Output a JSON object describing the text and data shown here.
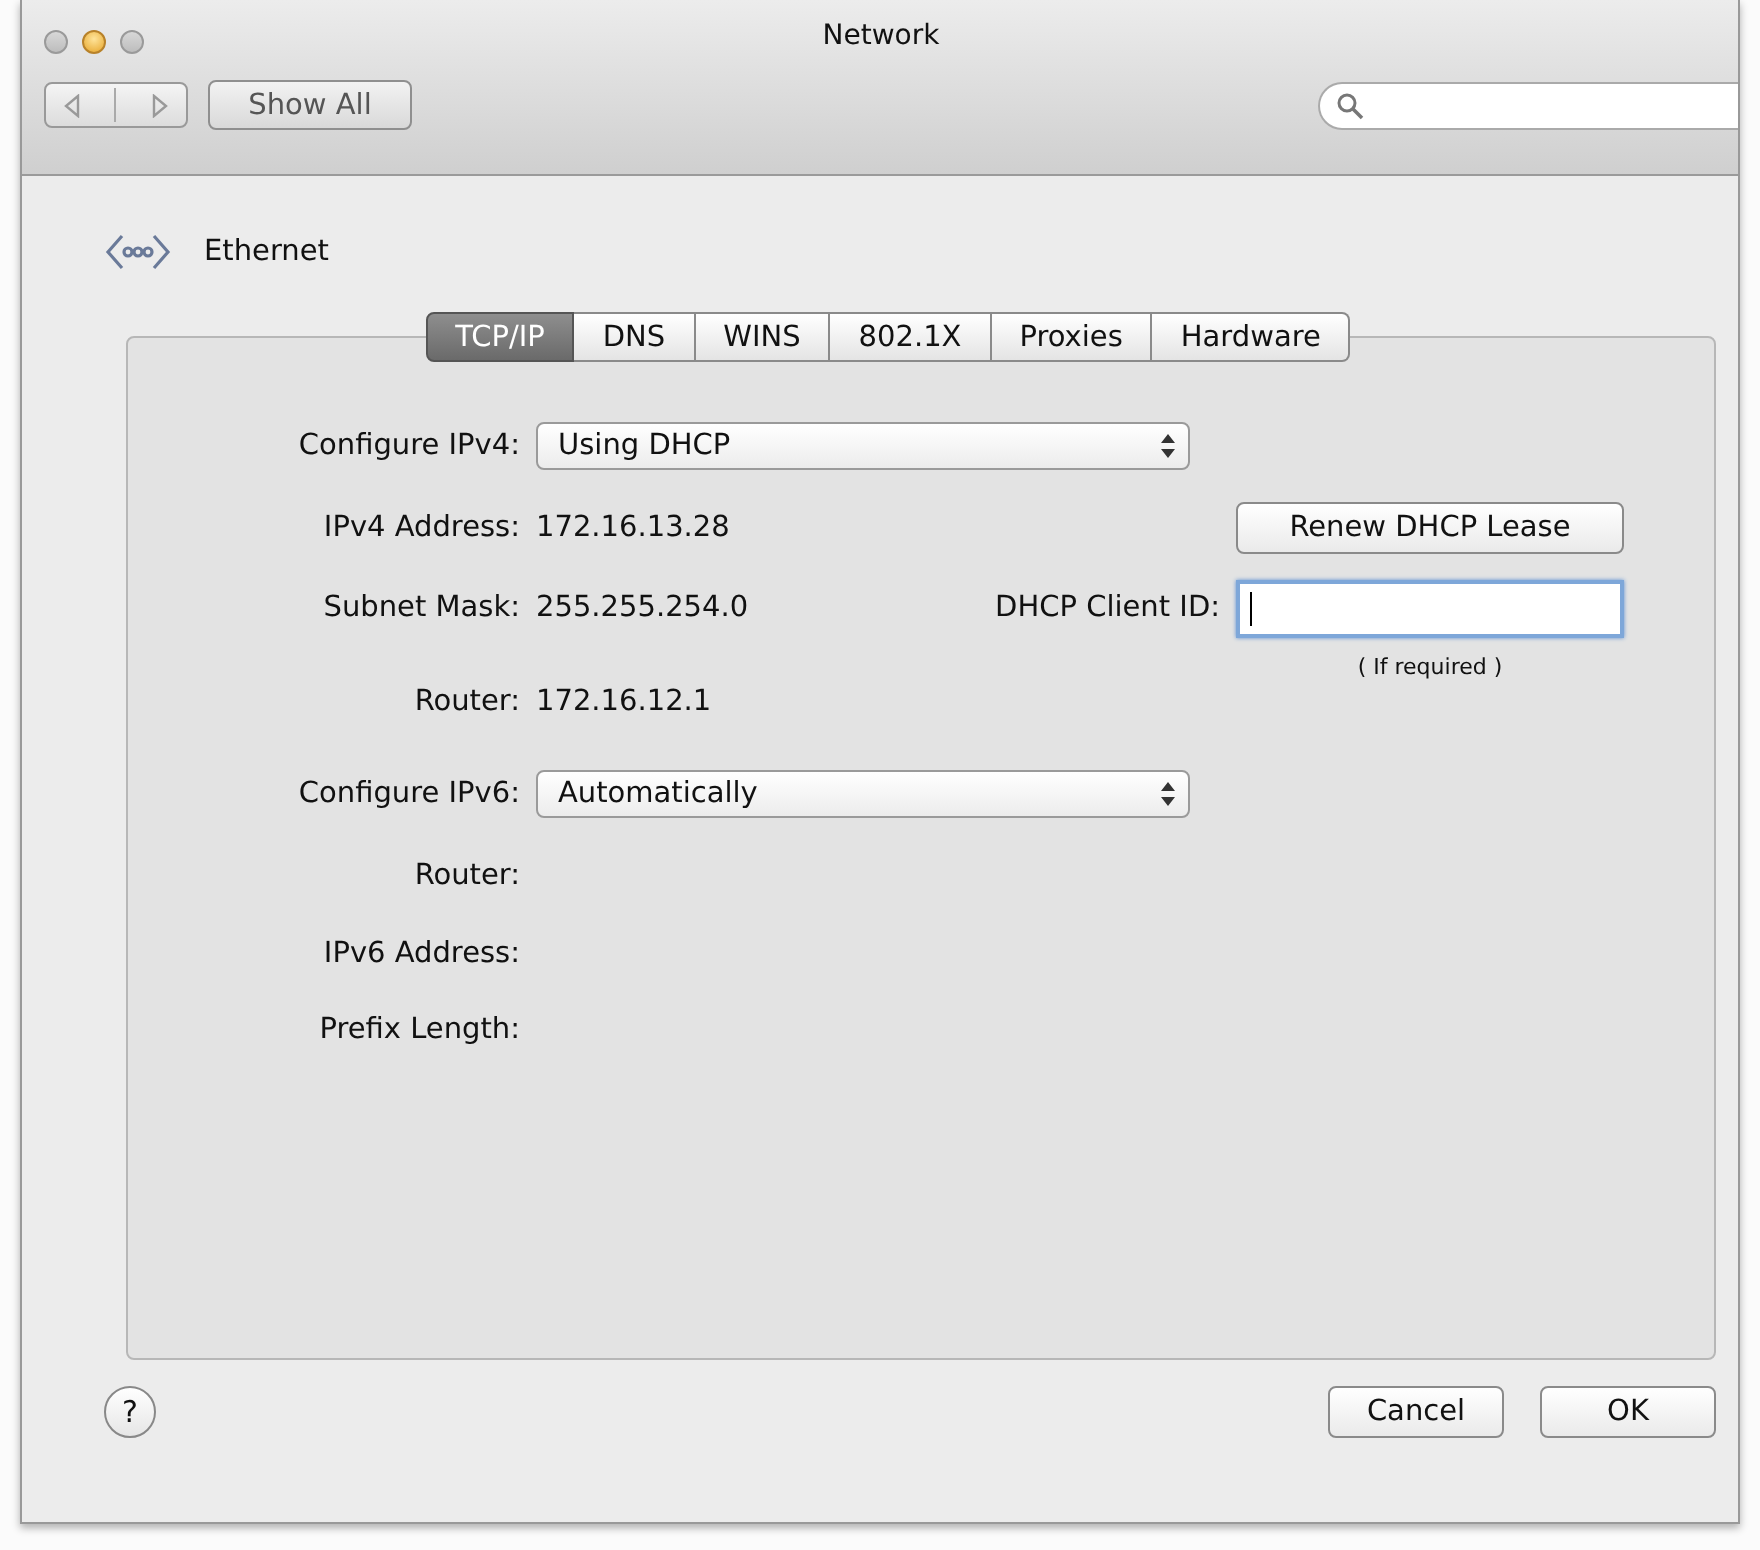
{
  "window": {
    "title": "Network"
  },
  "toolbar": {
    "show_all": "Show All"
  },
  "service": {
    "name": "Ethernet"
  },
  "tabs": [
    {
      "label": "TCP/IP",
      "selected": true
    },
    {
      "label": "DNS",
      "selected": false
    },
    {
      "label": "WINS",
      "selected": false
    },
    {
      "label": "802.1X",
      "selected": false
    },
    {
      "label": "Proxies",
      "selected": false
    },
    {
      "label": "Hardware",
      "selected": false
    }
  ],
  "rows": [
    {
      "kind": "popup",
      "label": "Configure IPv4:",
      "value": "Using DHCP"
    },
    {
      "kind": "text",
      "label": "IPv4 Address:",
      "value": "172.16.13.28"
    },
    {
      "kind": "text",
      "label": "Subnet Mask:",
      "value": "255.255.254.0"
    },
    {
      "kind": "text",
      "label": "Router:",
      "value": "172.16.12.1"
    },
    {
      "kind": "popup",
      "label": "Configure IPv6:",
      "value": "Automatically"
    },
    {
      "kind": "text",
      "label": "Router:"
    },
    {
      "kind": "text",
      "label": "IPv6 Address:"
    },
    {
      "kind": "text",
      "label": "Prefix Length:"
    }
  ],
  "renew_button": "Renew DHCP Lease",
  "client_id": {
    "label": "DHCP Client ID:",
    "hint": "( If required )",
    "focused": true
  },
  "help": "?",
  "buttons": [
    "Cancel",
    "OK"
  ]
}
